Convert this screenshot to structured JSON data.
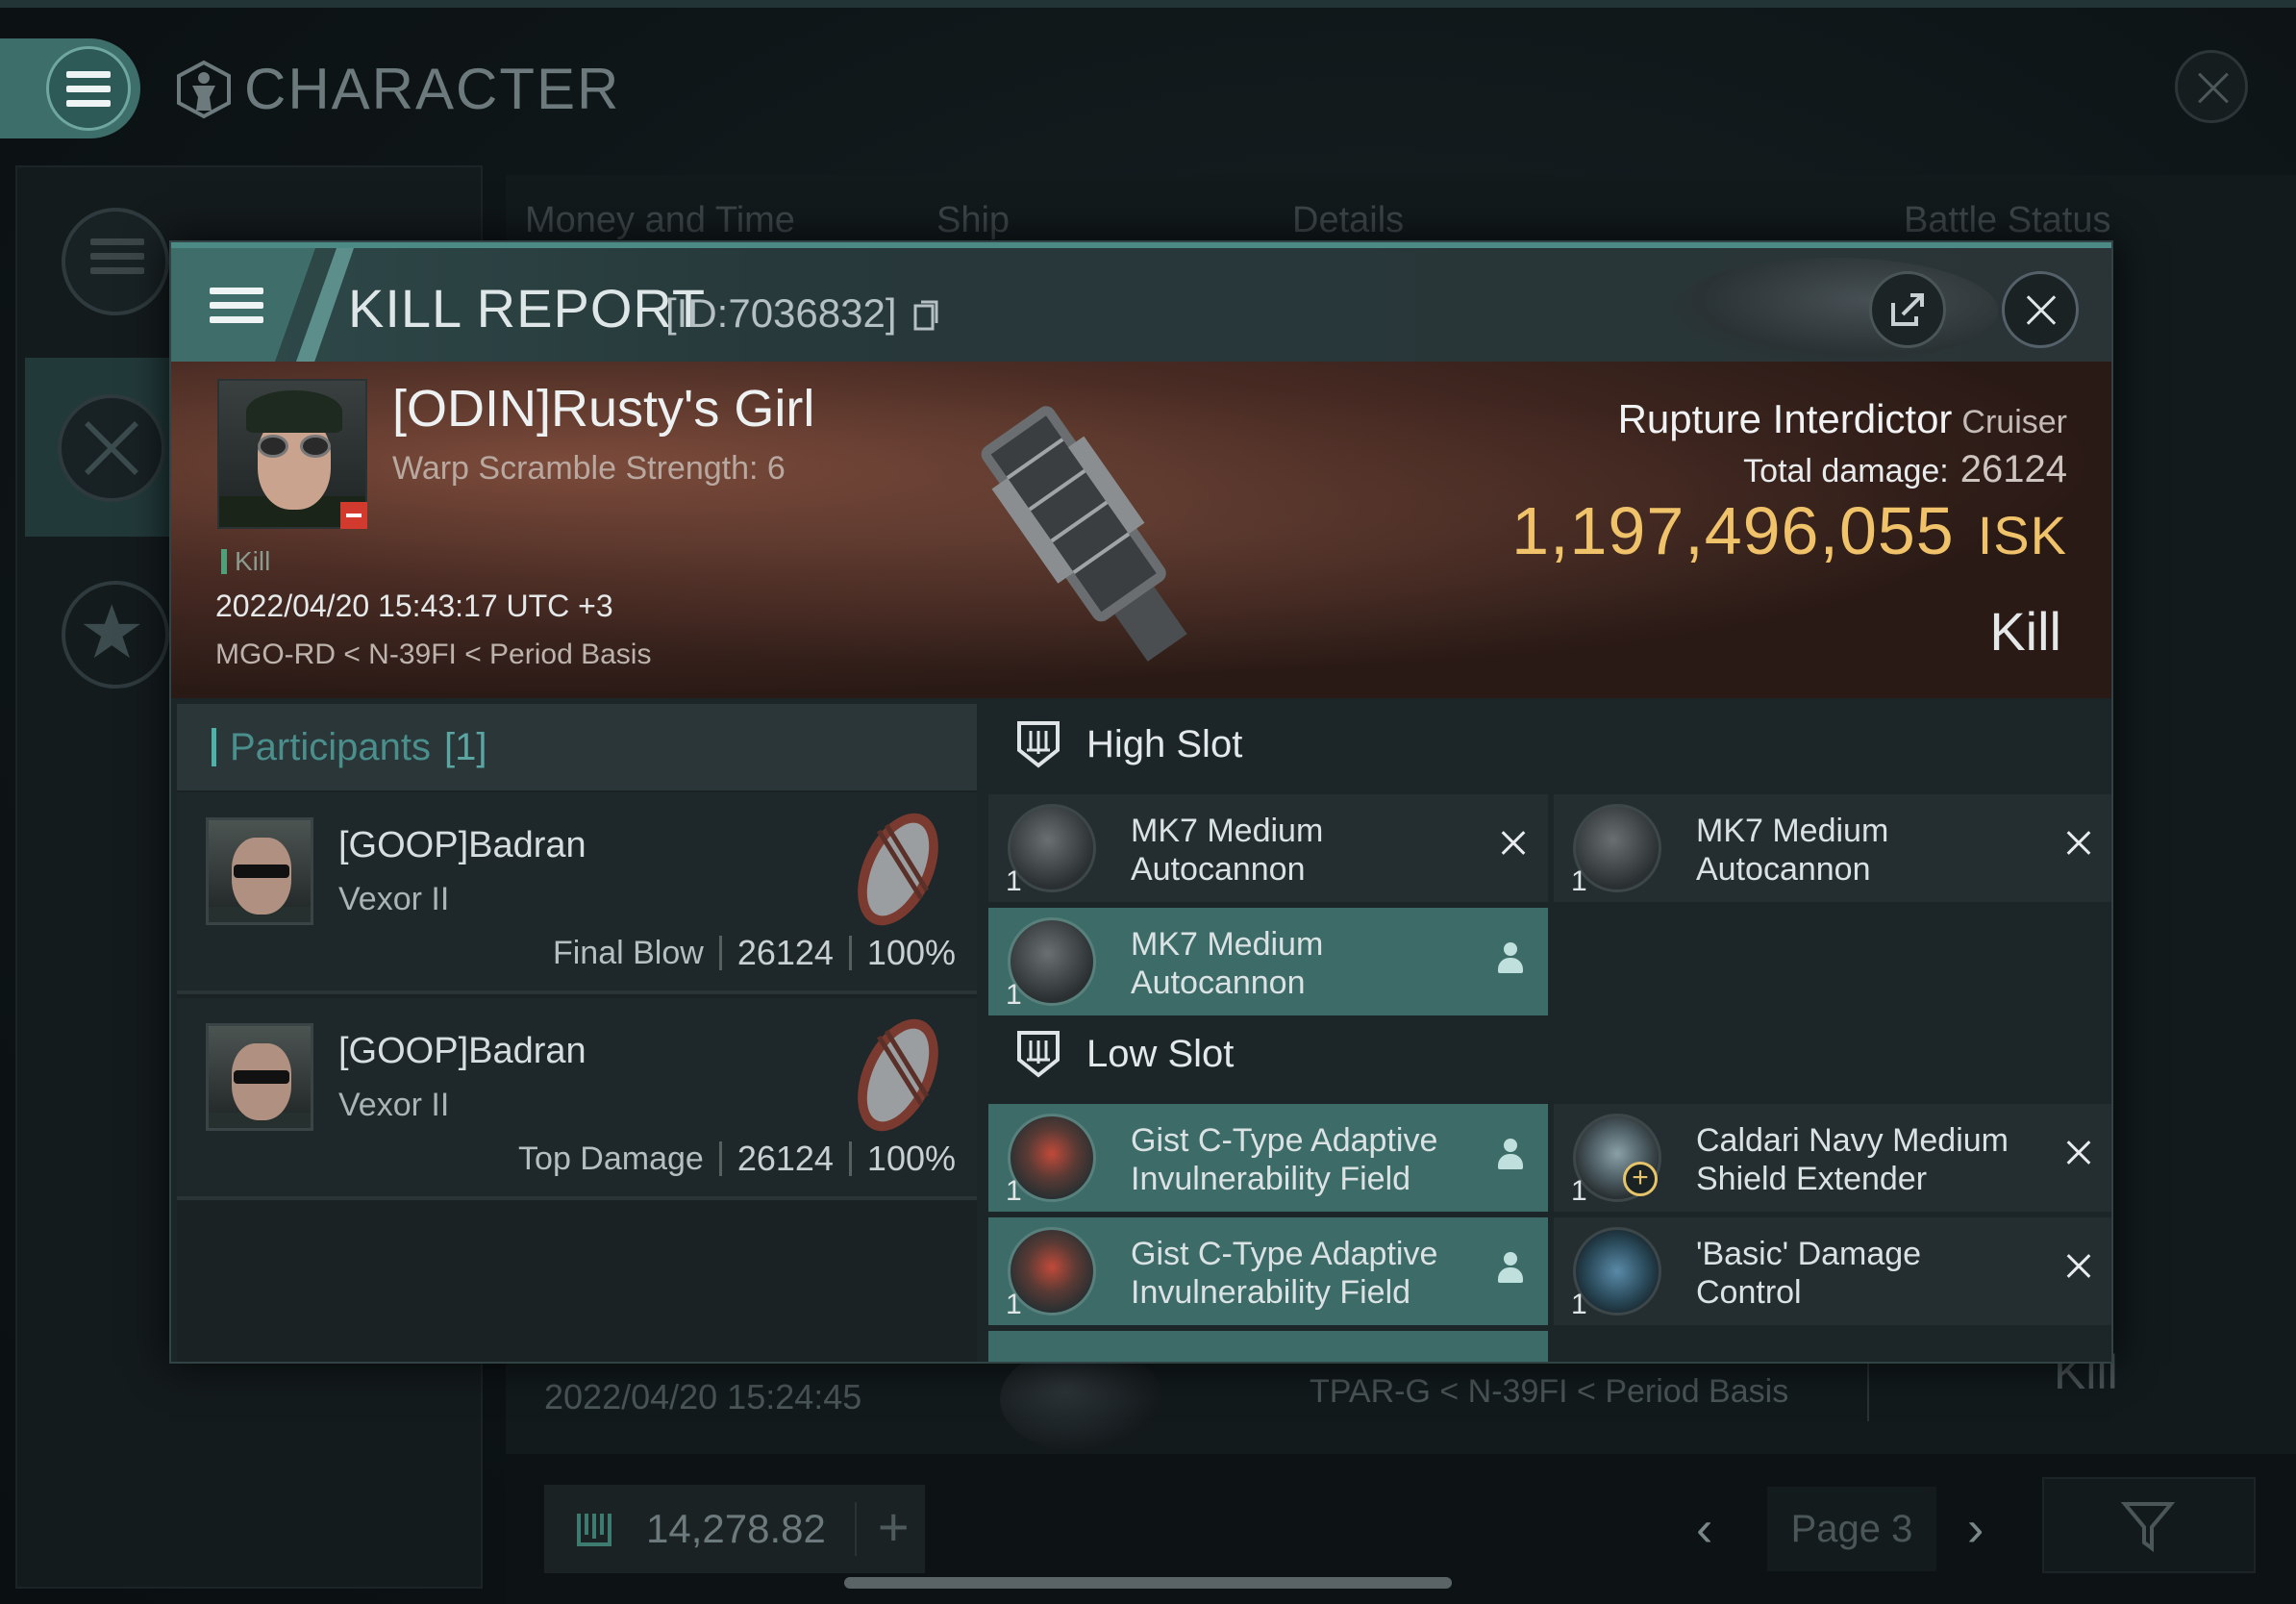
{
  "window": {
    "title": "CHARACTER"
  },
  "background_table": {
    "headers": [
      "Money and Time",
      "Ship",
      "Details",
      "Battle Status"
    ],
    "row": {
      "date": "2022/04/20 15:24:45",
      "location": "TPAR-G < N-39FI < Period Basis",
      "status": "Kill"
    },
    "wallet": "14,278.82",
    "page": "Page 3"
  },
  "kill_report": {
    "title": "KILL REPORT",
    "id": "[ID:7036832]",
    "victim": {
      "name": "[ODIN]Rusty's Girl",
      "subtitle": "Warp Scramble Strength: 6",
      "tag": "Kill",
      "datetime": "2022/04/20 15:43:17 UTC +3",
      "location": "MGO-RD < N-39FI < Period Basis"
    },
    "ship": {
      "name": "Rupture Interdictor",
      "class": "Cruiser",
      "total_damage_label": "Total damage:",
      "total_damage": "26124",
      "value": "1,197,496,055",
      "value_unit": "ISK",
      "result": "Kill"
    },
    "participants": {
      "label": "Participants",
      "count": "[1]",
      "list": [
        {
          "name": "[GOOP]Badran",
          "ship": "Vexor II",
          "label": "Final Blow",
          "damage": "26124",
          "percent": "100%"
        },
        {
          "name": "[GOOP]Badran",
          "ship": "Vexor II",
          "label": "Top Damage",
          "damage": "26124",
          "percent": "100%"
        }
      ]
    },
    "high_slot": {
      "label": "High Slot",
      "items": [
        {
          "qty": "1",
          "name": "MK7 Medium Autocannon",
          "state": "destroyed"
        },
        {
          "qty": "1",
          "name": "MK7 Medium Autocannon",
          "state": "destroyed"
        },
        {
          "qty": "1",
          "name": "MK7 Medium Autocannon",
          "state": "dropped"
        }
      ]
    },
    "low_slot": {
      "label": "Low Slot",
      "items": [
        {
          "qty": "1",
          "name": "Gist C-Type Adaptive Invulnerability Field",
          "state": "dropped"
        },
        {
          "qty": "1",
          "name": "Caldari Navy Medium Shield Extender",
          "state": "destroyed"
        },
        {
          "qty": "1",
          "name": "Gist C-Type Adaptive Invulnerability Field",
          "state": "dropped"
        },
        {
          "qty": "1",
          "name": "'Basic' Damage Control",
          "state": "destroyed"
        }
      ]
    }
  },
  "colors": {
    "accent": "#4c8a86",
    "isk": "#f0c36a",
    "highlight_row": "#3d6b67"
  }
}
